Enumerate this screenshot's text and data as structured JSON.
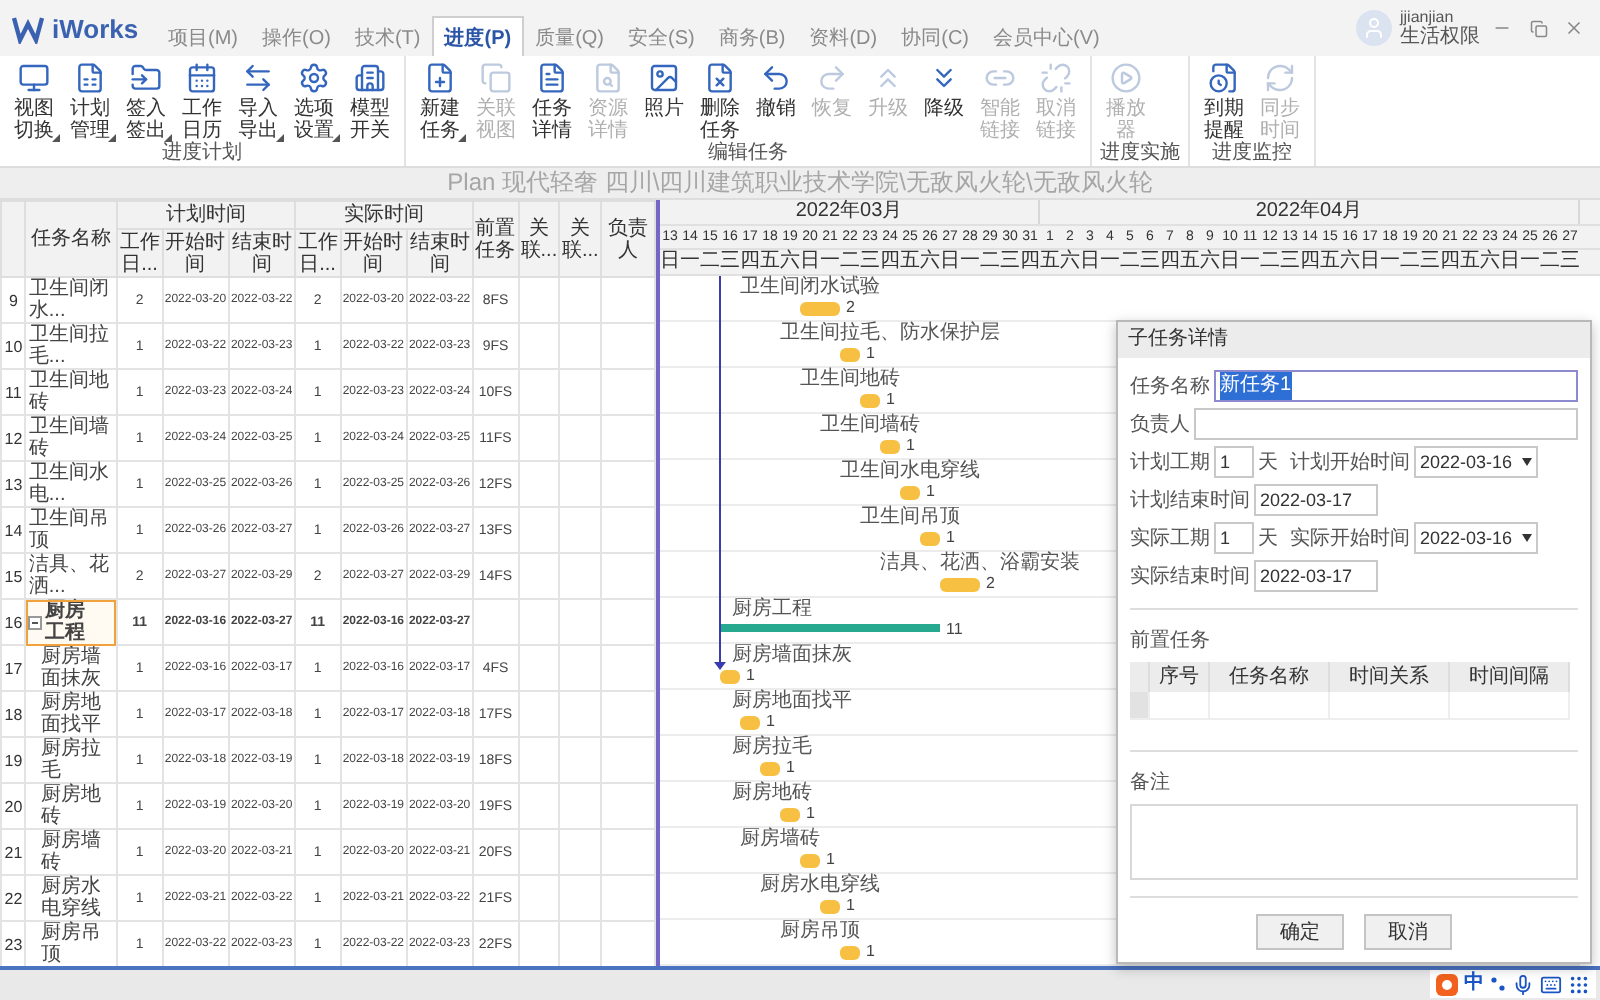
{
  "app": {
    "logo": "iWorks"
  },
  "menu_tabs": [
    {
      "label": "项目(M)",
      "selected": false
    },
    {
      "label": "操作(O)",
      "selected": false
    },
    {
      "label": "技术(T)",
      "selected": false
    },
    {
      "label": "进度(P)",
      "selected": true
    },
    {
      "label": "质量(Q)",
      "selected": false
    },
    {
      "label": "安全(S)",
      "selected": false
    },
    {
      "label": "商务(B)",
      "selected": false
    },
    {
      "label": "资料(D)",
      "selected": false
    },
    {
      "label": "协同(C)",
      "selected": false
    },
    {
      "label": "会员中心(V)",
      "selected": false
    }
  ],
  "user": {
    "name": "jjianjian",
    "role": "生活权限"
  },
  "ribbon_groups": [
    {
      "label": "进度计划",
      "buttons": [
        {
          "label": "视图切换",
          "dropdown": true,
          "disabled": false
        },
        {
          "label": "计划管理",
          "dropdown": true,
          "disabled": false
        },
        {
          "label": "签入签出",
          "dropdown": true,
          "disabled": false
        },
        {
          "label": "工作日历",
          "dropdown": false,
          "disabled": false
        },
        {
          "label": "导入导出",
          "dropdown": true,
          "disabled": false
        },
        {
          "label": "选项设置",
          "dropdown": true,
          "disabled": false
        },
        {
          "label": "模型开关",
          "dropdown": false,
          "disabled": false
        }
      ]
    },
    {
      "label": "编辑任务",
      "buttons": [
        {
          "label": "新建任务",
          "dropdown": true,
          "disabled": false
        },
        {
          "label": "关联视图",
          "dropdown": false,
          "disabled": true
        },
        {
          "label": "任务详情",
          "dropdown": false,
          "disabled": false
        },
        {
          "label": "资源详情",
          "dropdown": false,
          "disabled": true
        },
        {
          "label": "照片",
          "dropdown": false,
          "disabled": false
        },
        {
          "label": "删除任务",
          "dropdown": false,
          "disabled": false
        },
        {
          "label": "撤销",
          "dropdown": false,
          "disabled": false
        },
        {
          "label": "恢复",
          "dropdown": false,
          "disabled": true
        },
        {
          "label": "升级",
          "dropdown": false,
          "disabled": true
        },
        {
          "label": "降级",
          "dropdown": false,
          "disabled": false
        },
        {
          "label": "智能链接",
          "dropdown": false,
          "disabled": true
        },
        {
          "label": "取消链接",
          "dropdown": false,
          "disabled": true
        }
      ]
    },
    {
      "label": "进度实施",
      "buttons": [
        {
          "label": "播放器",
          "dropdown": false,
          "disabled": true
        }
      ]
    },
    {
      "label": "进度监控",
      "buttons": [
        {
          "label": "到期提醒",
          "dropdown": false,
          "disabled": false
        },
        {
          "label": "同步时间",
          "dropdown": false,
          "disabled": true
        }
      ]
    }
  ],
  "plan_title": "Plan 现代轻奢 四川\\四川建筑职业技术学院\\无敌风火轮\\无敌风火轮",
  "table": {
    "name_column": "任务名称",
    "header_groups": [
      {
        "label": "计划时间",
        "columns": [
          "工作日...",
          "开始时间",
          "结束时间"
        ]
      },
      {
        "label": "实际时间",
        "columns": [
          "工作日...",
          "开始时间",
          "结束时间"
        ]
      }
    ],
    "extra_columns": [
      "前置任务",
      "关联...",
      "关联...",
      "负责人"
    ],
    "rows": [
      {
        "id": "9",
        "kind": "task",
        "name": "卫生间闭水...",
        "plan": [
          "2",
          "2022-03-20",
          "2022-03-22"
        ],
        "actual": [
          "2",
          "2022-03-20",
          "2022-03-22"
        ],
        "predecessor": "8FS",
        "selected": false,
        "bar": {
          "label": "卫生间闭水试验",
          "duration": "2"
        }
      },
      {
        "id": "10",
        "kind": "task",
        "name": "卫生间拉毛...",
        "plan": [
          "1",
          "2022-03-22",
          "2022-03-23"
        ],
        "actual": [
          "1",
          "2022-03-22",
          "2022-03-23"
        ],
        "predecessor": "9FS",
        "selected": false,
        "bar": {
          "label": "卫生间拉毛、防水保护层",
          "duration": "1"
        }
      },
      {
        "id": "11",
        "kind": "task",
        "name": "卫生间地砖",
        "plan": [
          "1",
          "2022-03-23",
          "2022-03-24"
        ],
        "actual": [
          "1",
          "2022-03-23",
          "2022-03-24"
        ],
        "predecessor": "10FS",
        "selected": false,
        "bar": {
          "label": "卫生间地砖",
          "duration": "1"
        }
      },
      {
        "id": "12",
        "kind": "task",
        "name": "卫生间墙砖",
        "plan": [
          "1",
          "2022-03-24",
          "2022-03-25"
        ],
        "actual": [
          "1",
          "2022-03-24",
          "2022-03-25"
        ],
        "predecessor": "11FS",
        "selected": false,
        "bar": {
          "label": "卫生间墙砖",
          "duration": "1"
        }
      },
      {
        "id": "13",
        "kind": "task",
        "name": "卫生间水电...",
        "plan": [
          "1",
          "2022-03-25",
          "2022-03-26"
        ],
        "actual": [
          "1",
          "2022-03-25",
          "2022-03-26"
        ],
        "predecessor": "12FS",
        "selected": false,
        "bar": {
          "label": "卫生间水电穿线",
          "duration": "1"
        }
      },
      {
        "id": "14",
        "kind": "task",
        "name": "卫生间吊顶",
        "plan": [
          "1",
          "2022-03-26",
          "2022-03-27"
        ],
        "actual": [
          "1",
          "2022-03-26",
          "2022-03-27"
        ],
        "predecessor": "13FS",
        "selected": false,
        "bar": {
          "label": "卫生间吊顶",
          "duration": "1"
        }
      },
      {
        "id": "15",
        "kind": "task",
        "name": "洁具、花洒...",
        "plan": [
          "2",
          "2022-03-27",
          "2022-03-29"
        ],
        "actual": [
          "2",
          "2022-03-27",
          "2022-03-29"
        ],
        "predecessor": "14FS",
        "selected": false,
        "bar": {
          "label": "洁具、花洒、浴霸安装",
          "duration": "2"
        }
      },
      {
        "id": "16",
        "kind": "summary",
        "name": "厨房工程",
        "plan": [
          "11",
          "2022-03-16",
          "2022-03-27"
        ],
        "actual": [
          "11",
          "2022-03-16",
          "2022-03-27"
        ],
        "selected": true,
        "expanded": true,
        "bar": {
          "label": "厨房工程",
          "duration": "11"
        },
        "children": [
          {
            "id": "17",
            "kind": "task",
            "name": "厨房墙面抹灰",
            "plan": [
              "1",
              "2022-03-16",
              "2022-03-17"
            ],
            "actual": [
              "1",
              "2022-03-16",
              "2022-03-17"
            ],
            "predecessor": "4FS",
            "selected": false,
            "bar": {
              "label": "厨房墙面抹灰",
              "duration": "1"
            }
          },
          {
            "id": "18",
            "kind": "task",
            "name": "厨房地面找平",
            "plan": [
              "1",
              "2022-03-17",
              "2022-03-18"
            ],
            "actual": [
              "1",
              "2022-03-17",
              "2022-03-18"
            ],
            "predecessor": "17FS",
            "selected": false,
            "bar": {
              "label": "厨房地面找平",
              "duration": "1"
            }
          },
          {
            "id": "19",
            "kind": "task",
            "name": "厨房拉毛",
            "plan": [
              "1",
              "2022-03-18",
              "2022-03-19"
            ],
            "actual": [
              "1",
              "2022-03-18",
              "2022-03-19"
            ],
            "predecessor": "18FS",
            "selected": false,
            "bar": {
              "label": "厨房拉毛",
              "duration": "1"
            }
          },
          {
            "id": "20",
            "kind": "task",
            "name": "厨房地砖",
            "plan": [
              "1",
              "2022-03-19",
              "2022-03-20"
            ],
            "actual": [
              "1",
              "2022-03-19",
              "2022-03-20"
            ],
            "predecessor": "19FS",
            "selected": false,
            "bar": {
              "label": "厨房地砖",
              "duration": "1"
            }
          },
          {
            "id": "21",
            "kind": "task",
            "name": "厨房墙砖",
            "plan": [
              "1",
              "2022-03-20",
              "2022-03-21"
            ],
            "actual": [
              "1",
              "2022-03-20",
              "2022-03-21"
            ],
            "predecessor": "20FS",
            "selected": false,
            "bar": {
              "label": "厨房墙砖",
              "duration": "1"
            }
          },
          {
            "id": "22",
            "kind": "task",
            "name": "厨房水电穿线",
            "plan": [
              "1",
              "2022-03-21",
              "2022-03-22"
            ],
            "actual": [
              "1",
              "2022-03-21",
              "2022-03-22"
            ],
            "predecessor": "21FS",
            "selected": false,
            "bar": {
              "label": "厨房水电穿线",
              "duration": "1"
            }
          },
          {
            "id": "23",
            "kind": "task",
            "name": "厨房吊顶",
            "plan": [
              "1",
              "2022-03-22",
              "2022-03-23"
            ],
            "actual": [
              "1",
              "2022-03-22",
              "2022-03-23"
            ],
            "predecessor": "22FS",
            "selected": false,
            "bar": {
              "label": "厨房吊顶",
              "duration": "1"
            }
          }
        ]
      }
    ]
  },
  "gantt": {
    "months": [
      {
        "label": "2022年03月",
        "days": [
          {
            "day": "13",
            "weekday": "日"
          },
          {
            "day": "14",
            "weekday": "一"
          },
          {
            "day": "15",
            "weekday": "二"
          },
          {
            "day": "16",
            "weekday": "三"
          },
          {
            "day": "17",
            "weekday": "四"
          },
          {
            "day": "18",
            "weekday": "五"
          },
          {
            "day": "19",
            "weekday": "六"
          },
          {
            "day": "20",
            "weekday": "日"
          },
          {
            "day": "21",
            "weekday": "一"
          },
          {
            "day": "22",
            "weekday": "二"
          },
          {
            "day": "23",
            "weekday": "三"
          },
          {
            "day": "24",
            "weekday": "四"
          },
          {
            "day": "25",
            "weekday": "五"
          },
          {
            "day": "26",
            "weekday": "六"
          },
          {
            "day": "27",
            "weekday": "日"
          },
          {
            "day": "28",
            "weekday": "一"
          },
          {
            "day": "29",
            "weekday": "二"
          },
          {
            "day": "30",
            "weekday": "三"
          },
          {
            "day": "31",
            "weekday": "四"
          }
        ]
      },
      {
        "label": "2022年04月",
        "days": [
          {
            "day": "1",
            "weekday": "五"
          },
          {
            "day": "2",
            "weekday": "六"
          },
          {
            "day": "3",
            "weekday": "日"
          },
          {
            "day": "4",
            "weekday": "一"
          },
          {
            "day": "5",
            "weekday": "二"
          },
          {
            "day": "6",
            "weekday": "三"
          },
          {
            "day": "7",
            "weekday": "四"
          },
          {
            "day": "8",
            "weekday": "五"
          },
          {
            "day": "9",
            "weekday": "六"
          },
          {
            "day": "10",
            "weekday": "日"
          },
          {
            "day": "11",
            "weekday": "一"
          },
          {
            "day": "12",
            "weekday": "二"
          },
          {
            "day": "13",
            "weekday": "三"
          },
          {
            "day": "14",
            "weekday": "四"
          },
          {
            "day": "15",
            "weekday": "五"
          },
          {
            "day": "16",
            "weekday": "六"
          },
          {
            "day": "17",
            "weekday": "日"
          },
          {
            "day": "18",
            "weekday": "一"
          },
          {
            "day": "19",
            "weekday": "二"
          },
          {
            "day": "20",
            "weekday": "三"
          },
          {
            "day": "21",
            "weekday": "四"
          },
          {
            "day": "22",
            "weekday": "五"
          },
          {
            "day": "23",
            "weekday": "六"
          },
          {
            "day": "24",
            "weekday": "日"
          },
          {
            "day": "25",
            "weekday": "一"
          },
          {
            "day": "26",
            "weekday": "二"
          },
          {
            "day": "27",
            "weekday": "三"
          }
        ]
      }
    ]
  },
  "dialog": {
    "title": "子任务详情",
    "fields": [
      {
        "kind": "text",
        "label": "任务名称",
        "value": "新任务1",
        "value_selected": true
      },
      {
        "kind": "text",
        "label": "负责人"
      },
      {
        "kind": "duration",
        "label": "计划工期",
        "value": "1",
        "unit": "天"
      },
      {
        "kind": "select",
        "label": "计划开始时间",
        "value": "2022-03-16"
      },
      {
        "kind": "date",
        "label": "计划结束时间",
        "value": "2022-03-17"
      },
      {
        "kind": "duration",
        "label": "实际工期",
        "value": "1",
        "unit": "天"
      },
      {
        "kind": "select",
        "label": "实际开始时间",
        "value": "2022-03-16"
      },
      {
        "kind": "date",
        "label": "实际结束时间",
        "value": "2022-03-17"
      }
    ],
    "predecessors_label": "前置任务",
    "predecessor_columns": [
      "序号",
      "任务名称",
      "时间关系",
      "时间间隔"
    ],
    "notes_label": "备注",
    "buttons": [
      "确定",
      "取消"
    ]
  },
  "ime": {
    "mode": "中"
  }
}
